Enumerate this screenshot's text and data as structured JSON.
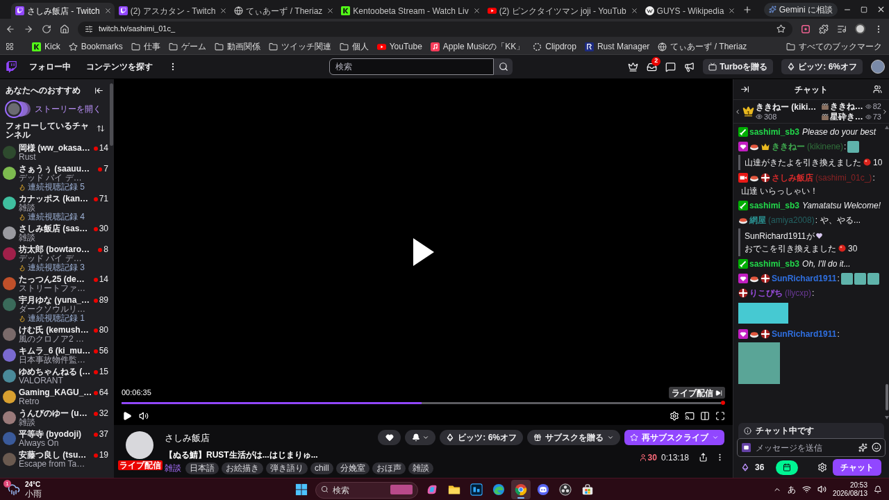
{
  "browser": {
    "tabs": [
      {
        "title": "さしみ飯店 - Twitch",
        "kind": "twitch",
        "selected": true
      },
      {
        "title": "(2) アスカタン - Twitch",
        "kind": "twitch",
        "selected": false
      },
      {
        "title": "てぃあーず / Theriaz",
        "kind": "globe",
        "selected": false
      },
      {
        "title": "Kentoobeta Stream - Watch Liv",
        "kind": "kick",
        "selected": false
      },
      {
        "title": "(2) ピンクタイツマン joji - YouTub",
        "kind": "youtube",
        "selected": false
      },
      {
        "title": "GUYS - Wikipedia",
        "kind": "wikipedia",
        "selected": false
      }
    ],
    "gemini_button": "Gemini に相談",
    "address": "twitch.tv/sashimi_01c_",
    "bookmarks": [
      {
        "label": "Kick",
        "kind": "kick"
      },
      {
        "label": "Bookmarks",
        "kind": "star"
      },
      {
        "label": "仕事",
        "kind": "folder"
      },
      {
        "label": "ゲーム",
        "kind": "folder"
      },
      {
        "label": "動画関係",
        "kind": "folder"
      },
      {
        "label": "ツイッチ関連",
        "kind": "folder"
      },
      {
        "label": "個人",
        "kind": "folder"
      },
      {
        "label": "YouTube",
        "kind": "youtube"
      },
      {
        "label": "Apple Musicの「KK」",
        "kind": "music"
      },
      {
        "label": "Clipdrop",
        "kind": "clipdrop"
      },
      {
        "label": "Rust Manager",
        "kind": "rust"
      },
      {
        "label": "てぃあーず / Theriaz",
        "kind": "globe"
      }
    ],
    "all_bookmarks": "すべてのブックマーク"
  },
  "twitch_nav": {
    "following": "フォロー中",
    "browse": "コンテンツを探す",
    "search": {
      "placeholder": "検索"
    },
    "inbox_badge": "2",
    "turbo_button": "Turboを贈る",
    "bits_button": "ビッツ: 6%オフ"
  },
  "sidebar": {
    "title": "あなたへのおすすめ",
    "story_button": "ストーリーを開く",
    "followed_heading": "フォローしているチャンネル",
    "channels": [
      {
        "name": "岡様 (ww_okasa…",
        "category": "Rust",
        "viewers": "14"
      },
      {
        "name": "さぁうぅ (saauu…",
        "category": "デッド バイ デ…",
        "viewers": "7",
        "streak": "連続視聴記録 5"
      },
      {
        "name": "カナッポス (kan…",
        "category": "雑談",
        "viewers": "71",
        "streak": "連続視聴記録 4"
      },
      {
        "name": "さしみ飯店 (sas…",
        "category": "雑談",
        "viewers": "30"
      },
      {
        "name": "坊太郎 (bowtaro…",
        "category": "デッド バイ デ…",
        "viewers": "8",
        "streak": "連続視聴記録 3"
      },
      {
        "name": "たっつん25 (de…",
        "category": "ストリートファ…",
        "viewers": "14"
      },
      {
        "name": "宇月ゆな (yuna_…",
        "category": "ダークソウルリ…",
        "viewers": "89",
        "streak": "連続視聴記録 1"
      },
      {
        "name": "けむ氏 (kemush…",
        "category": "風のクロノア2 …",
        "viewers": "80"
      },
      {
        "name": "キムラ_6 (ki_mu…",
        "category": "日本事故物件監…",
        "viewers": "56"
      },
      {
        "name": "ゆめちゃんねる (…",
        "category": "VALORANT",
        "viewers": "15"
      },
      {
        "name": "Gaming_KAGU_…",
        "category": "Retro",
        "viewers": "64"
      },
      {
        "name": "うんびのゆー (u…",
        "category": "雑談",
        "viewers": "32"
      },
      {
        "name": "平等寺 (byodoji)",
        "category": "Always On",
        "viewers": "37"
      },
      {
        "name": "安藤つ良し (tsu…",
        "category": "Escape from Ta…",
        "viewers": "19"
      }
    ]
  },
  "player": {
    "elapsed": "00:06:35",
    "live_button": "ライブ配信",
    "level": 0.5
  },
  "stream_info": {
    "channel": "さしみ飯店",
    "live_badge": "ライブ配信",
    "title": "【ぬる鯖】RUST生活がは...はじまりゅ...",
    "category": "雑談",
    "tags": [
      "日本語",
      "お絵描き",
      "弾き語り",
      "chill",
      "分娩室",
      "おほ声",
      "雑談"
    ],
    "bits_button": "ビッツ: 6%オフ",
    "gift_button": "サブスクを贈る",
    "resub_button": "再サブスクライブ",
    "viewers": "30",
    "uptime": "0:13:18"
  },
  "chat": {
    "title": "チャット",
    "leaderboard": {
      "top": {
        "rank": "1",
        "name": "ききねー (kiki…",
        "score": "308"
      },
      "others": [
        {
          "name": "ききね…",
          "score": "82"
        },
        {
          "name": "星砕き…",
          "score": "73"
        }
      ]
    },
    "messages": [
      {
        "kind": "chat",
        "badges": [
          {
            "kind": "sword"
          }
        ],
        "user": "sashimi_sb3",
        "color": "#22d84a",
        "text": "Please do your best",
        "italic": true
      },
      {
        "kind": "chat",
        "badges": [
          {
            "kind": "gem"
          },
          {
            "kind": "sushi"
          },
          {
            "kind": "crown"
          }
        ],
        "user": "ききねー",
        "login": "(kikinene)",
        "color": "#3fa84e",
        "separator": ":",
        "emotes": [
          {
            "kind": "small"
          }
        ]
      },
      {
        "kind": "redemption",
        "parts": [
          {
            "kind": "text",
            "text": "山達がきたよを引き換えました"
          }
        ],
        "cost": "10"
      },
      {
        "kind": "chat",
        "badges": [
          {
            "kind": "camera"
          },
          {
            "kind": "sushi"
          },
          {
            "kind": "flower"
          }
        ],
        "user": "さしみ飯店",
        "login": "(sashimi_01c_)",
        "color": "#d42a2a",
        "separator": ":",
        "text": "山達 いらっしゃい！",
        "italic": false
      },
      {
        "kind": "chat",
        "badges": [
          {
            "kind": "sword"
          }
        ],
        "user": "sashimi_sb3",
        "color": "#22d84a",
        "text": "Yamatatsu Welcome!",
        "italic": true
      },
      {
        "kind": "chat",
        "badges": [
          {
            "kind": "sushi"
          }
        ],
        "user": "網屋",
        "login": "(amiya2008)",
        "color": "#2a8f8f",
        "separator": ":",
        "text": "や、やる...",
        "italic": false
      },
      {
        "kind": "redemption",
        "parts": [
          {
            "kind": "text",
            "text": "SunRichard1911が"
          },
          {
            "kind": "heart"
          },
          {
            "kind": "text",
            "text": "おでこを引き換えました"
          }
        ],
        "cost": "30"
      },
      {
        "kind": "chat",
        "badges": [
          {
            "kind": "sword"
          }
        ],
        "user": "sashimi_sb3",
        "color": "#22d84a",
        "text": "Oh, I'll do it...",
        "italic": true
      },
      {
        "kind": "chat",
        "badges": [
          {
            "kind": "gem"
          },
          {
            "kind": "sushi"
          },
          {
            "kind": "flower"
          }
        ],
        "user": "SunRichard1911",
        "color": "#2f6fe0",
        "separator": ":",
        "emotes": [
          {
            "kind": "small"
          },
          {
            "kind": "small"
          },
          {
            "kind": "small"
          }
        ]
      },
      {
        "kind": "chat",
        "badges": [
          {
            "kind": "flower"
          }
        ],
        "user": "りこぴち",
        "login": "(llycxp)",
        "color": "#9a4cdf",
        "separator": ":",
        "emotes": [
          {
            "kind": "wide"
          }
        ]
      },
      {
        "kind": "chat",
        "badges": [
          {
            "kind": "gem"
          },
          {
            "kind": "sushi"
          },
          {
            "kind": "flower"
          }
        ],
        "user": "SunRichard1911",
        "color": "#2f6fe0",
        "separator": ":",
        "emotes": [
          {
            "kind": "large"
          }
        ]
      }
    ],
    "notice": "チャット中です",
    "input": {
      "placeholder": "メッセージを送信"
    },
    "bits": "36",
    "chat_button": "チャット"
  },
  "taskbar": {
    "weather_badge": "1",
    "temperature": "24°C",
    "weather": "小雨",
    "search": {
      "placeholder": "検索"
    },
    "apps": [
      {
        "kind": "start",
        "selected": false
      },
      {
        "kind": "copilot",
        "selected": false
      },
      {
        "kind": "explorer",
        "selected": false
      },
      {
        "kind": "photoshop",
        "selected": false
      },
      {
        "kind": "edge",
        "selected": false
      },
      {
        "kind": "chrome",
        "selected": true
      },
      {
        "kind": "discord",
        "selected": false
      },
      {
        "kind": "obs",
        "selected": false
      },
      {
        "kind": "store",
        "selected": false
      }
    ],
    "ime": "あ",
    "time": "20:53",
    "date": "2026/08/13"
  }
}
